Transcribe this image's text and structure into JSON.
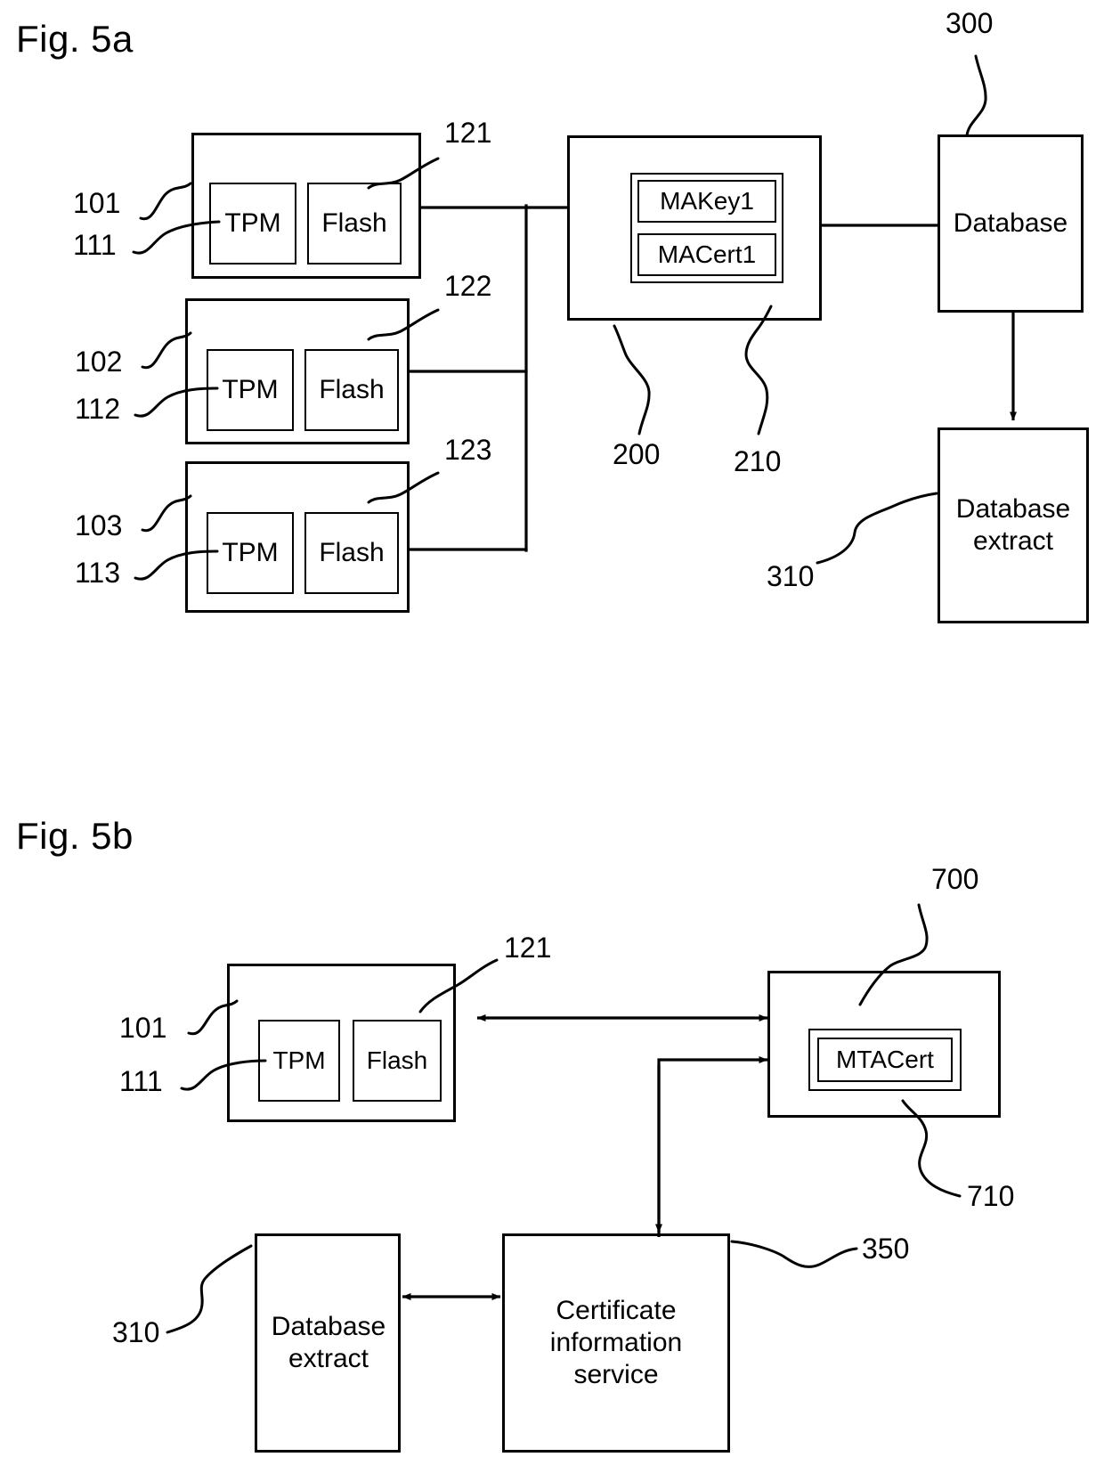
{
  "figures": [
    {
      "id": "fig5a",
      "title": "Fig. 5a",
      "boxes": {
        "device1": {
          "label": "",
          "tpm": "TPM",
          "flash": "Flash"
        },
        "device2": {
          "label": "",
          "tpm": "TPM",
          "flash": "Flash"
        },
        "device3": {
          "label": "",
          "tpm": "TPM",
          "flash": "Flash"
        },
        "authority": {
          "key": "MAKey1",
          "cert": "MACert1"
        },
        "database": "Database",
        "database_extract": "Database\nextract"
      },
      "refs": {
        "device1_outer": "101",
        "device1_tpm": "111",
        "device1_flash": "121",
        "device2_outer": "102",
        "device2_tpm": "112",
        "device2_flash": "122",
        "device3_outer": "103",
        "device3_tpm": "113",
        "device3_flash": "123",
        "authority_outer": "200",
        "authority_inner": "210",
        "database": "300",
        "database_extract": "310"
      }
    },
    {
      "id": "fig5b",
      "title": "Fig. 5b",
      "boxes": {
        "device1": {
          "tpm": "TPM",
          "flash": "Flash"
        },
        "trust_anchor": {
          "cert": "MTACert"
        },
        "database_extract": "Database\nextract",
        "cert_service": "Certificate\ninformation\nservice"
      },
      "refs": {
        "device1_outer": "101",
        "device1_tpm": "111",
        "device1_flash": "121",
        "trust_anchor_outer": "700",
        "trust_anchor_cert": "710",
        "cert_service": "350",
        "database_extract": "310"
      }
    }
  ],
  "strings": {
    "tpm": "TPM",
    "flash": "Flash",
    "makey1": "MAKey1",
    "macert1": "MACert1",
    "mtacert": "MTACert",
    "database": "Database",
    "database_extract_l1": "Database",
    "database_extract_l2": "extract",
    "cert_service_l1": "Certificate",
    "cert_service_l2": "information",
    "cert_service_l3": "service"
  },
  "colors": {
    "ink": "#000000",
    "paper": "#ffffff"
  }
}
